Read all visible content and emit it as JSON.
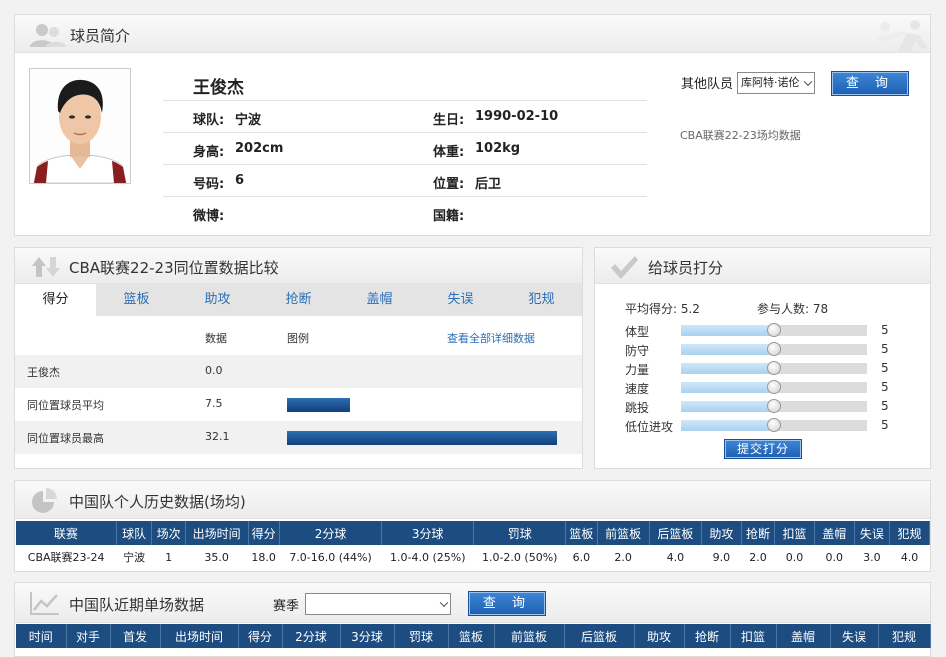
{
  "profile": {
    "section_title": "球员简介",
    "name": "王俊杰",
    "rows": [
      {
        "l1": "球队:",
        "v1": "宁波",
        "l2": "生日:",
        "v2": "1990-02-10"
      },
      {
        "l1": "身高:",
        "v1": "202cm",
        "l2": "体重:",
        "v2": "102kg"
      },
      {
        "l1": "号码:",
        "v1": "6",
        "l2": "位置:",
        "v2": "后卫"
      },
      {
        "l1": "微博:",
        "v1": "",
        "l2": "国籍:",
        "v2": ""
      }
    ],
    "other_players_label": "其他队员",
    "other_players_selected": "库阿特·诺伦",
    "query_button": "查 询",
    "stats_note": "CBA联赛22-23场均数据"
  },
  "compare": {
    "title": "CBA联赛22-23同位置数据比较",
    "tabs": [
      "得分",
      "篮板",
      "助攻",
      "抢断",
      "盖帽",
      "失误",
      "犯规"
    ],
    "active_tab": 0,
    "col_data": "数据",
    "col_legend": "图例",
    "detail_link": "查看全部详细数据",
    "rows": [
      {
        "name": "王俊杰",
        "value": "0.0",
        "num": 0.0
      },
      {
        "name": "同位置球员平均",
        "value": "7.5",
        "num": 7.5
      },
      {
        "name": "同位置球员最高",
        "value": "32.1",
        "num": 32.1
      }
    ],
    "max_num": 32.1
  },
  "rating": {
    "title": "给球员打分",
    "avg_label": "平均得分: 5.2",
    "participants_label": "参与人数: 78",
    "items": [
      {
        "label": "体型",
        "value": "5",
        "level": 0.5
      },
      {
        "label": "防守",
        "value": "5",
        "level": 0.5
      },
      {
        "label": "力量",
        "value": "5",
        "level": 0.5
      },
      {
        "label": "速度",
        "value": "5",
        "level": 0.5
      },
      {
        "label": "跳投",
        "value": "5",
        "level": 0.5
      },
      {
        "label": "低位进攻",
        "value": "5",
        "level": 0.5
      }
    ],
    "submit_button": "提交打分"
  },
  "history": {
    "title": "中国队个人历史数据(场均)",
    "headers": [
      "联赛",
      "球队",
      "场次",
      "出场时间",
      "得分",
      "2分球",
      "3分球",
      "罚球",
      "篮板",
      "前篮板",
      "后篮板",
      "助攻",
      "抢断",
      "扣篮",
      "盖帽",
      "失误",
      "犯规"
    ],
    "rows": [
      [
        "CBA联赛23-24",
        "宁波",
        "1",
        "35.0",
        "18.0",
        "7.0-16.0 (44%)",
        "1.0-4.0 (25%)",
        "1.0-2.0 (50%)",
        "6.0",
        "2.0",
        "4.0",
        "9.0",
        "2.0",
        "0.0",
        "0.0",
        "3.0",
        "4.0"
      ]
    ]
  },
  "recent": {
    "title": "中国队近期单场数据",
    "season_label": "赛季",
    "season_value": "",
    "query_button": "查 询",
    "headers": [
      "时间",
      "对手",
      "首发",
      "出场时间",
      "得分",
      "2分球",
      "3分球",
      "罚球",
      "篮板",
      "前篮板",
      "后篮板",
      "助攻",
      "抢断",
      "扣篮",
      "盖帽",
      "失误",
      "犯规"
    ]
  }
}
